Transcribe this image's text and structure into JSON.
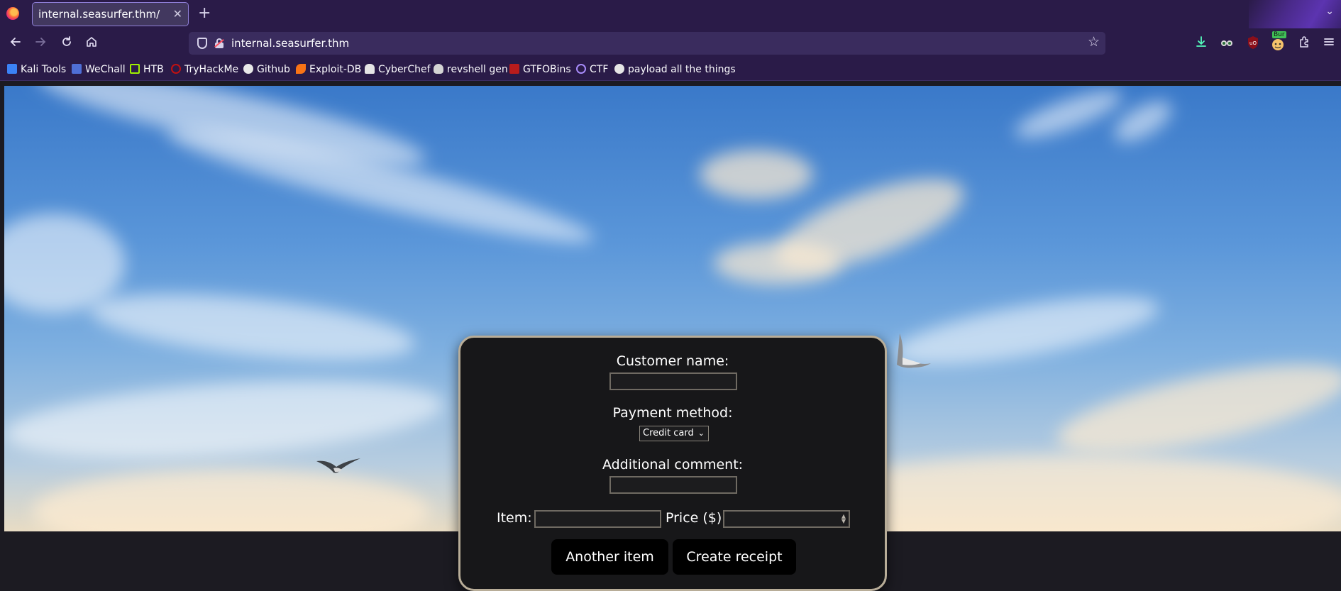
{
  "browser": {
    "tab_title": "internal.seasurfer.thm/",
    "url": "internal.seasurfer.thm",
    "tab_close_glyph": "✕",
    "new_tab_glyph": "+",
    "tab_list_glyph": "⌄"
  },
  "bookmarks": [
    {
      "label": "Kali Tools",
      "color": "#3b82f6"
    },
    {
      "label": "WeChall",
      "color": "#4f6fd6"
    },
    {
      "label": "HTB",
      "color": "#9fef00"
    },
    {
      "label": "TryHackMe",
      "color": "#c11111"
    },
    {
      "label": "Github",
      "color": "#e8e8e8"
    },
    {
      "label": "Exploit-DB",
      "color": "#f97316"
    },
    {
      "label": "CyberChef",
      "color": "#e5e5e5"
    },
    {
      "label": "revshell gen",
      "color": "#d4d4d4"
    },
    {
      "label": "GTFOBins",
      "color": "#b91c1c"
    },
    {
      "label": "CTF",
      "color": "#a78bfa"
    },
    {
      "label": "payload all the things",
      "color": "#e5e5e5"
    }
  ],
  "form": {
    "customer_name_label": "Customer name:",
    "customer_name_value": "",
    "payment_method_label": "Payment method:",
    "payment_method_selected": "Credit card",
    "additional_comment_label": "Additional comment:",
    "additional_comment_value": "",
    "item_label": "Item:",
    "item_value": "",
    "price_label": "Price ($):",
    "price_value": "",
    "another_item_button": "Another item",
    "create_receipt_button": "Create receipt"
  },
  "icons": {
    "back": "back-arrow-icon",
    "forward": "forward-arrow-icon",
    "reload": "reload-icon",
    "home": "home-icon",
    "bookmark_star": "bookmark-star-icon",
    "downloads": "download-icon",
    "extensions": "extensions-icon",
    "menu": "hamburger-menu-icon"
  },
  "extension_badge": "Bur"
}
